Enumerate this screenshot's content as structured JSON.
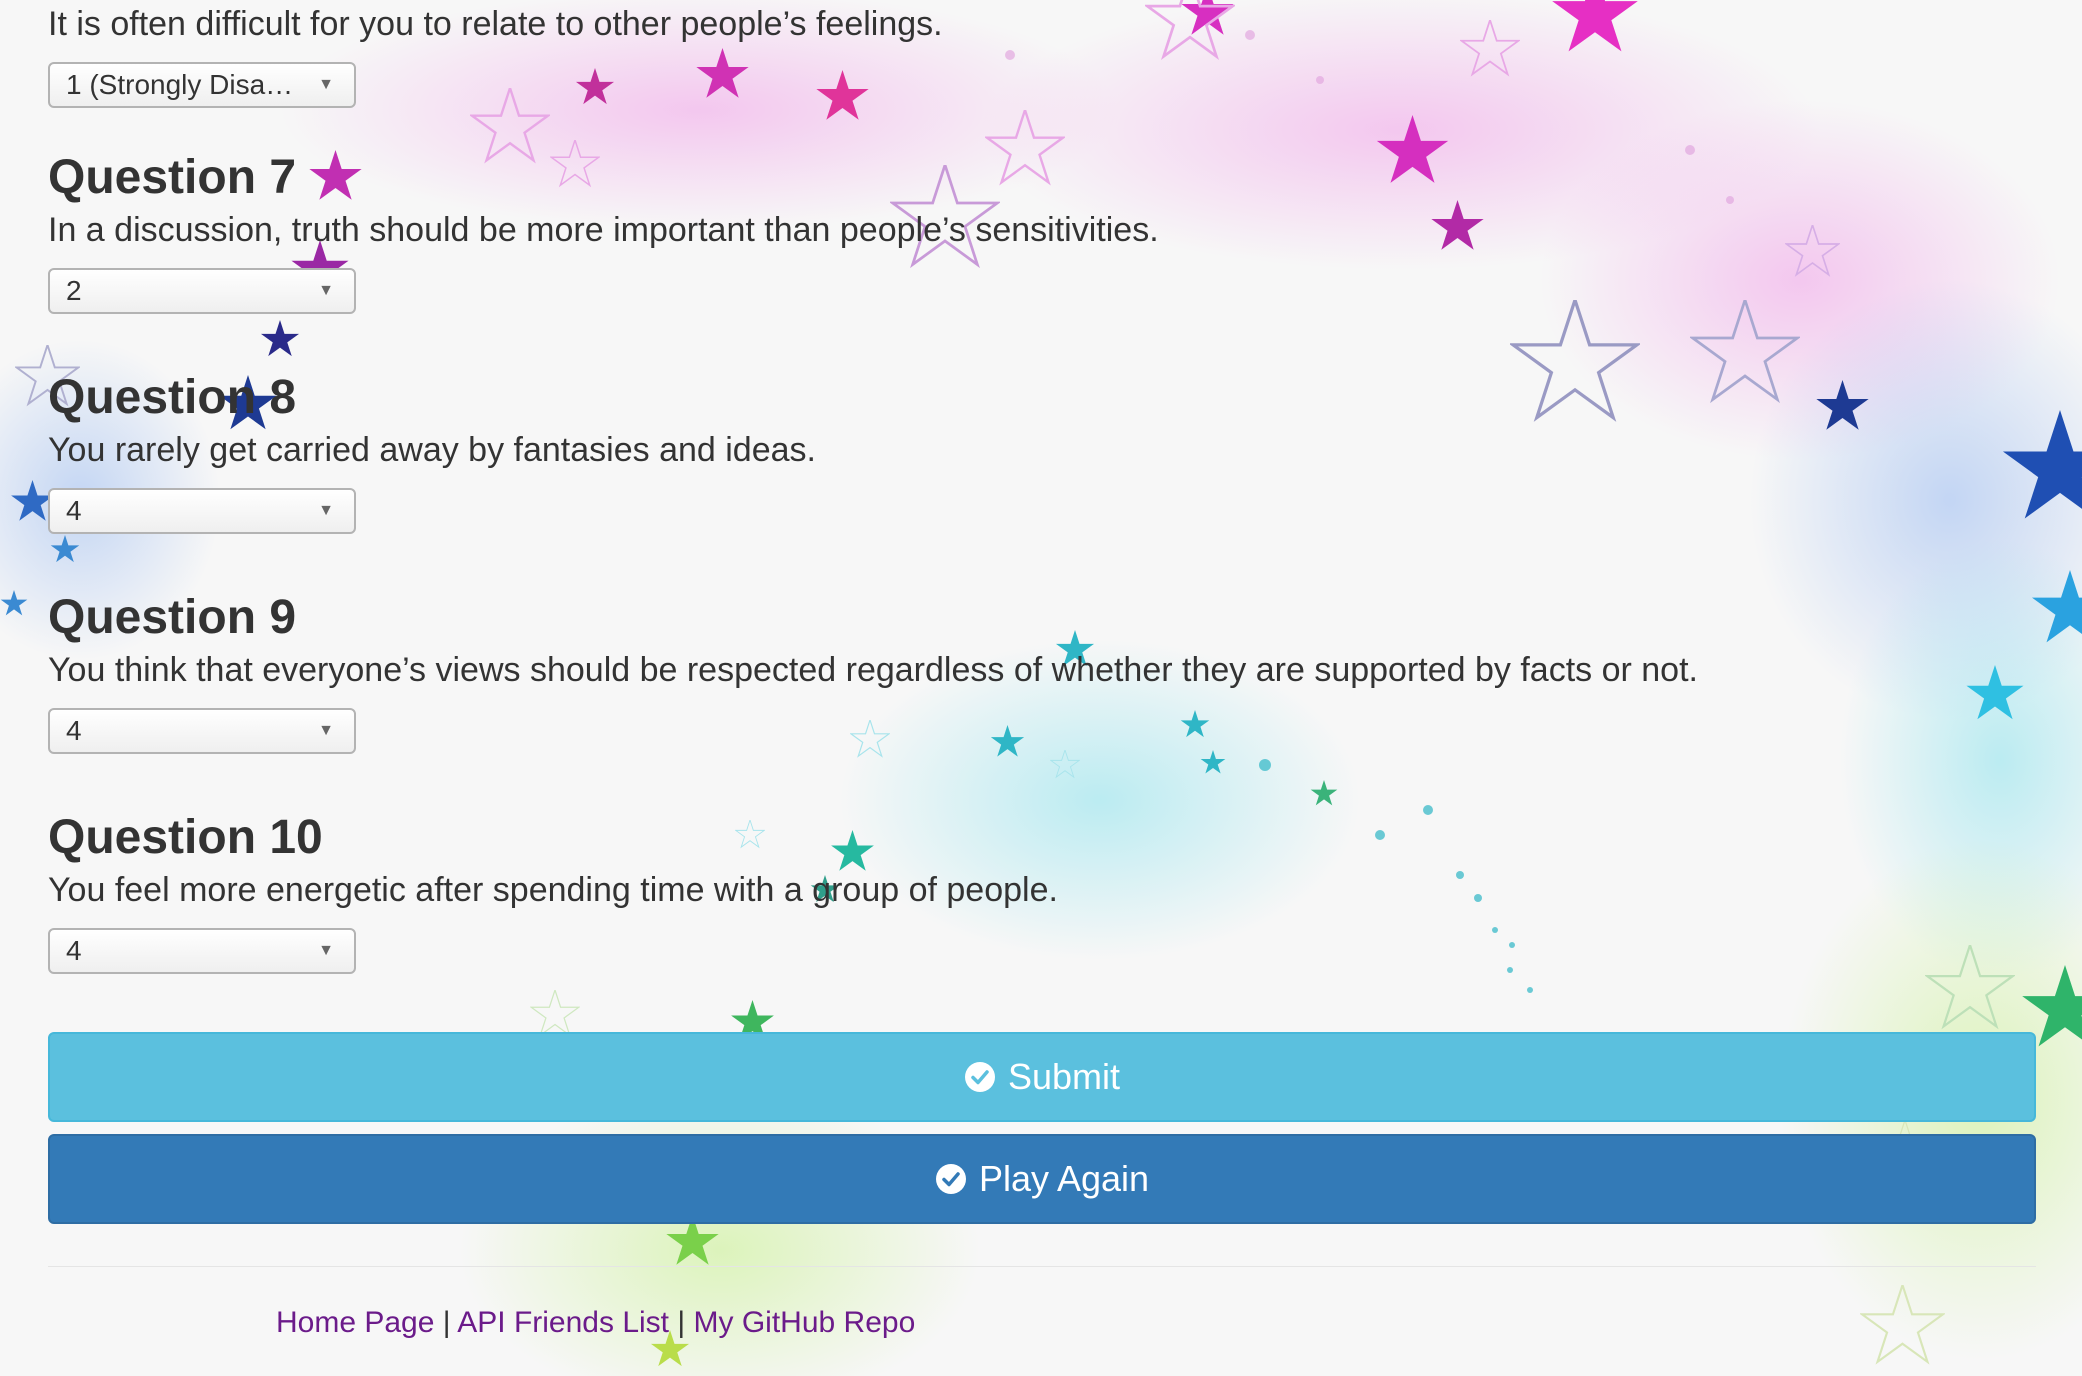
{
  "questions": [
    {
      "heading": "",
      "text": "It is often difficult for you to relate to other people’s feelings.",
      "selected": "1 (Strongly Disa…"
    },
    {
      "heading": "Question 7",
      "text": "In a discussion, truth should be more important than people’s sensitivities.",
      "selected": "2"
    },
    {
      "heading": "Question 8",
      "text": "You rarely get carried away by fantasies and ideas.",
      "selected": "4"
    },
    {
      "heading": "Question 9",
      "text": "You think that everyone’s views should be respected regardless of whether they are supported by facts or not.",
      "selected": "4"
    },
    {
      "heading": "Question 10",
      "text": "You feel more energetic after spending time with a group of people.",
      "selected": "4"
    }
  ],
  "buttons": {
    "submit_label": "Submit",
    "play_again_label": "Play Again"
  },
  "footer": {
    "links": [
      {
        "label": "Home Page"
      },
      {
        "label": "API Friends List"
      },
      {
        "label": "My GitHub Repo"
      }
    ],
    "separator": "|"
  },
  "colors": {
    "submit_bg": "#5bc0de",
    "play_again_bg": "#337ab7",
    "link": "#6b1b8a",
    "text": "#333333"
  },
  "icons": {
    "button_icon": "check-circle-icon",
    "select_caret": "caret-down-icon",
    "background": "stars-background"
  }
}
